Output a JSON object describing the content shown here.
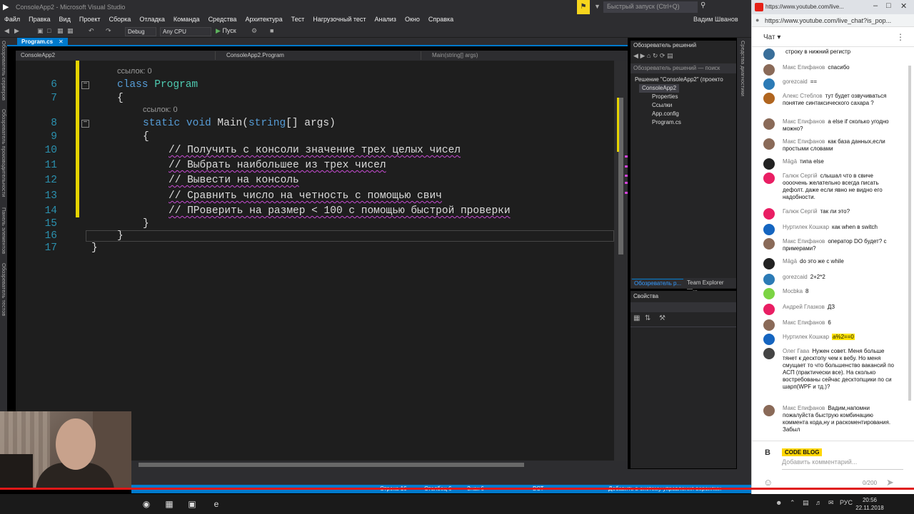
{
  "vs": {
    "title": "ConsoleApp2 - Microsoft Visual Studio",
    "quick_launch": "Быстрый запуск (Ctrl+Q)",
    "user": "Вадим Шванов",
    "menu": [
      "Файл",
      "Правка",
      "Вид",
      "Проект",
      "Сборка",
      "Отладка",
      "Команда",
      "Средства",
      "Архитектура",
      "Тест",
      "Нагрузочный тест",
      "Анализ",
      "Окно",
      "Справка"
    ],
    "toolbar": {
      "config": "Debug",
      "platform": "Any CPU",
      "run": "Пуск"
    },
    "side_labels": [
      "Обозреватель серверов",
      "Обозреватель производительности",
      "Панель элементов",
      "Обозреватель тестов"
    ],
    "right_label": "Средства диагностики",
    "tab": "Program.cs",
    "nav": {
      "project": "ConsoleApp2",
      "class": "ConsoleApp2.Program",
      "member": "Main(string[] args)"
    },
    "code": {
      "ref1": "ссылок: 0",
      "ref2": "ссылок: 0",
      "lines": [
        {
          "n": "6",
          "kw": "class",
          "ty": "Program"
        },
        {
          "n": "7",
          "text": "{"
        },
        {
          "n": "8",
          "kw": "static void",
          "fn": "Main(",
          "kw2": "string",
          "rest": "[] args)"
        },
        {
          "n": "9",
          "text": "{"
        },
        {
          "n": "10",
          "text": "// Получить с консоли значение трех целых чисел"
        },
        {
          "n": "11",
          "text": "// Выбрать наибольшее из трех чисел"
        },
        {
          "n": "12",
          "text": "// Вывести на консоль"
        },
        {
          "n": "13",
          "text": "// Сравнить число на четность с помощью свич"
        },
        {
          "n": "14",
          "text": "// ПРоверить на размер < 100 с помощью быстрой проверки"
        },
        {
          "n": "15",
          "text": "}"
        },
        {
          "n": "16",
          "text": "}"
        },
        {
          "n": "17",
          "text": "}"
        }
      ]
    },
    "status": {
      "line": "Строка 16",
      "col": "Столбец 6",
      "ch": "Знак 6",
      "ins": "ВСТ",
      "scm": "Добавить в систему управления версиями"
    },
    "solution": {
      "header": "Обозреватель решений",
      "search": "Обозреватель решений — поиск",
      "nodes": [
        "Решение \"ConsoleApp2\" (проекто",
        "ConsoleApp2",
        "Properties",
        "Ссылки",
        "App.config",
        "Program.cs"
      ],
      "tab1": "Обозреватель р...",
      "tab2": "Team Explorer —..."
    },
    "properties": {
      "header": "Свойства"
    }
  },
  "browser": {
    "tab_title": "https://www.youtube.com/live...",
    "url": "https://www.youtube.com/live_chat?is_pop...",
    "chat_label": "Чат"
  },
  "chat": [
    {
      "author": "",
      "text": "строку в нижний регистр",
      "color": "#3a6f9a"
    },
    {
      "author": "Макс Епифанов",
      "text": "спасибо",
      "color": "#8a6a58"
    },
    {
      "author": "gorezcaid",
      "text": "==",
      "color": "#2c7bb6"
    },
    {
      "author": "Алекс Стеблов",
      "text": "тут будет озвучиваться понятие синтаксического сахара ?",
      "color": "#b0651f"
    },
    {
      "author": "Макс Епифанов",
      "text": "а else if сколько угодно можно?",
      "color": "#8a6a58"
    },
    {
      "author": "Макс Епифанов",
      "text": "как база данных,если простыми словами",
      "color": "#8a6a58"
    },
    {
      "author": "Māgā",
      "text": "типа else",
      "color": "#222"
    },
    {
      "author": "Галюк Сергій",
      "text": "слышал что в свиче оооочень желательно всегда писать дефолт. даже если явно не видно его надобности.",
      "color": "#e91e63"
    },
    {
      "author": "Галюк Сергій",
      "text": "так ли это?",
      "color": "#e91e63"
    },
    {
      "author": "Нуртилек Кошкар",
      "text": "как when в switch",
      "color": "#1565c0"
    },
    {
      "author": "Макс Епифанов",
      "text": "оператор DO будет? с примерами?",
      "color": "#8a6a58"
    },
    {
      "author": "Māgā",
      "text": "do это же с while",
      "color": "#222"
    },
    {
      "author": "gorezcaid",
      "text": "2+2*2",
      "color": "#2c7bb6"
    },
    {
      "author": "Mocbka",
      "text": "8",
      "color": "#7cd444"
    },
    {
      "author": "Андрей Глазков",
      "text": "ДЗ",
      "color": "#e91e63"
    },
    {
      "author": "Макс Епифанов",
      "text": "6",
      "color": "#8a6a58"
    },
    {
      "author": "Нуртилек Кошкар",
      "text": "a%2==0",
      "color": "#1565c0",
      "hl": true
    },
    {
      "author": "Олег Гава",
      "text": "Нужен совет. Меня больше тянет к десктопу чем к вебу. Но меня смущает то что большенство вакансий по АСП (практически все). На сколько востребованы сейчас десктопщики по си шарп(WPF и тд.)?",
      "color": "#444"
    },
    {
      "author": "Макс Епифанов",
      "text": "Вадим,напомни пожалуйста быструю комбинацию коммента кода,ну и раскоментирования. Забыл",
      "color": "#8a6a58"
    }
  ],
  "chat_footer": {
    "badge": "CODE BLOG",
    "placeholder": "Добавить комментарий...",
    "counter": "0/200"
  },
  "taskbar": {
    "lang": "РУС",
    "time": "20:56",
    "date": "22.11.2018"
  }
}
